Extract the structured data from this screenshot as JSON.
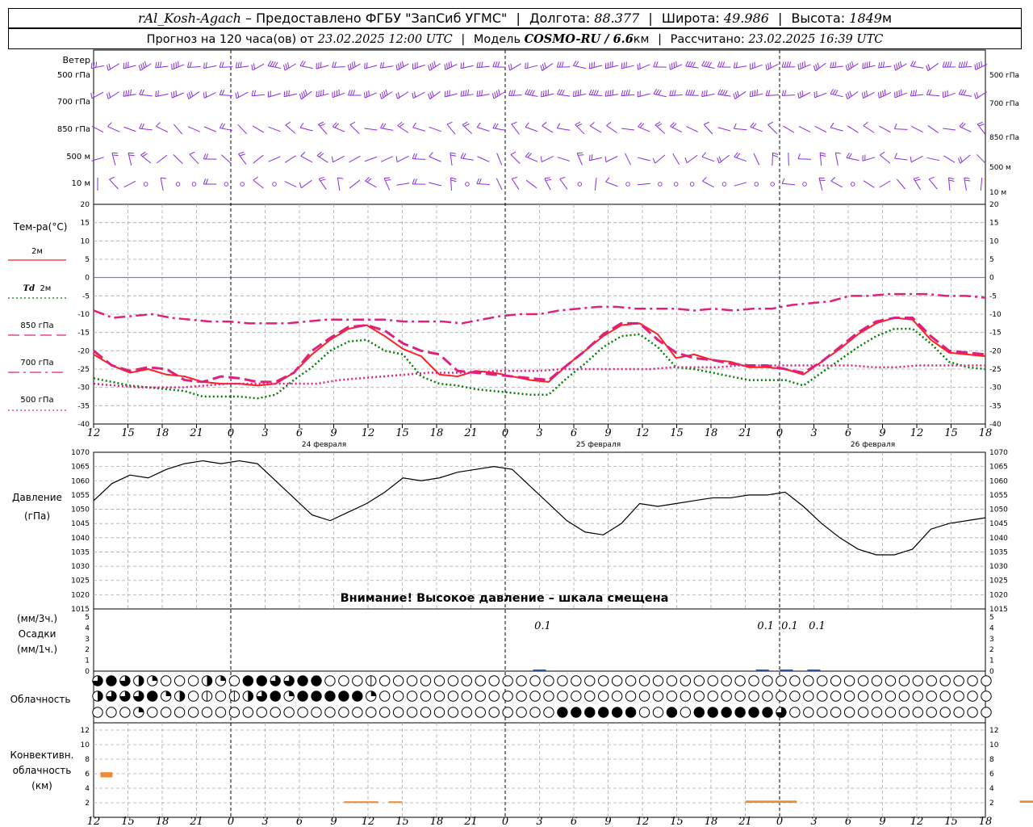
{
  "header": {
    "station": "rAl_Kosh-Agach",
    "dash": "–",
    "provider": "Предоставлено ФГБУ \"ЗапСиб УГМС\"",
    "lon_label": "Долгота:",
    "lon": "88.377",
    "lat_label": "Широта:",
    "lat": "49.986",
    "alt_label": "Высота:",
    "alt": "1849",
    "alt_unit": "м",
    "forecast_label": "Прогноз на 120 часа(ов)  от",
    "forecast_time": "23.02.2025 12:00 UTC",
    "model_label": "Модель",
    "model": "COSMO-RU / 6.6",
    "model_unit": "км",
    "calc_label": "Рассчитано:",
    "calc_time": "23.02.2025 16:39 UTC"
  },
  "panels": {
    "wind": {
      "title": "Ветер",
      "levels": [
        "500 гПа",
        "700 гПа",
        "850 гПа",
        "500 м",
        "10  м"
      ]
    },
    "temp": {
      "title": "Тем-ра(°C)",
      "legend": [
        {
          "label": "2м",
          "color": "#ff2020",
          "style": "solid"
        },
        {
          "label_it": "Td",
          "label": "2м",
          "color": "#008000",
          "style": "dotted"
        },
        {
          "label": "850 гПа",
          "color": "#e0207f",
          "style": "dashed"
        },
        {
          "label": "700 гПа",
          "color": "#e0207f",
          "style": "dashdot"
        },
        {
          "label": "500 гПа",
          "color": "#e0207f",
          "style": "dotted"
        }
      ]
    },
    "pressure": {
      "title": "Давление",
      "unit": "(гПа)",
      "warning": "Внимание! Высокое давление – шкала смещена"
    },
    "precip": {
      "unit1": "(мм/3ч.)",
      "title": "Осадки",
      "unit2": "(мм/1ч.)"
    },
    "clouds": {
      "title": "Облачность"
    },
    "convective": {
      "title1": "Конвективн.",
      "title2": "облачность",
      "unit": "(км)"
    }
  },
  "chart_data": [
    {
      "type": "line",
      "title": "Тем-ра(°C)",
      "x_hours_utc": [
        "12",
        "15",
        "18",
        "21",
        "0",
        "3",
        "6",
        "9",
        "12",
        "15",
        "18",
        "21",
        "0",
        "3",
        "6",
        "9",
        "12",
        "15",
        "18",
        "21",
        "0",
        "3",
        "6",
        "9",
        "12",
        "15",
        "18"
      ],
      "days": [
        {
          "label": "24 февраля",
          "tick_index": 7
        },
        {
          "label": "25 февраля",
          "tick_index": 15
        },
        {
          "label": "26 февраля",
          "tick_index": 23
        }
      ],
      "ylim": [
        -40,
        20
      ],
      "yticks": [
        20,
        15,
        10,
        5,
        0,
        -5,
        -10,
        -15,
        -20,
        -25,
        -30,
        -35,
        -40
      ],
      "series": [
        {
          "name": "2м",
          "color": "#ff2020",
          "values": [
            -21,
            -24,
            -26,
            -25,
            -26.5,
            -27,
            -28.5,
            -29,
            -29,
            -29.5,
            -29,
            -26,
            -21,
            -17,
            -14,
            -13,
            -16,
            -19.5,
            -21.5,
            -26.5,
            -27,
            -25.5,
            -26,
            -27,
            -28,
            -28.5,
            -24,
            -20,
            -16,
            -13,
            -12.5,
            -15.5,
            -22,
            -21,
            -22.5,
            -23,
            -24.5,
            -24.5,
            -25,
            -26.5,
            -23,
            -19.5,
            -15.5,
            -12.5,
            -11,
            -11.5,
            -17,
            -20.5,
            -21,
            -21.5
          ]
        },
        {
          "name": "Td 2м",
          "color": "#008000",
          "values": [
            -27.5,
            -28.5,
            -29.5,
            -30,
            -30.5,
            -31,
            -32.5,
            -32.5,
            -32.5,
            -33,
            -32,
            -28,
            -24.5,
            -20,
            -17.5,
            -17,
            -20,
            -21,
            -27,
            -29,
            -29.5,
            -30.5,
            -31,
            -31.5,
            -32,
            -32,
            -27.5,
            -23.5,
            -19,
            -16,
            -15.5,
            -19,
            -24.5,
            -25,
            -26,
            -27,
            -28,
            -28,
            -28,
            -29.5,
            -26,
            -22.5,
            -19,
            -16,
            -14,
            -14,
            -18,
            -23,
            -24.5,
            -25
          ]
        },
        {
          "name": "850 гПа",
          "color": "#e0207f",
          "values": [
            -20,
            -24,
            -25.5,
            -24.5,
            -25,
            -28,
            -28.5,
            -27,
            -27.5,
            -28.5,
            -28.5,
            -26,
            -20,
            -16.5,
            -13.5,
            -13,
            -14.5,
            -18,
            -20,
            -21,
            -25.5,
            -26,
            -26.5,
            -27,
            -27.5,
            -28,
            -24,
            -20,
            -15.5,
            -12.5,
            -12.5,
            -17,
            -20.5,
            -22,
            -22.5,
            -23.5,
            -24,
            -24,
            -25,
            -26,
            -23,
            -19,
            -15,
            -12,
            -11,
            -11,
            -16,
            -20,
            -20.5,
            -21
          ]
        },
        {
          "name": "700 гПа",
          "color": "#e0207f",
          "values": [
            -9,
            -11,
            -10.5,
            -10,
            -11,
            -11.5,
            -12,
            -12,
            -12.5,
            -12.5,
            -12.5,
            -12,
            -11.5,
            -11.5,
            -11.5,
            -11.5,
            -12,
            -12,
            -12,
            -12.5,
            -11.5,
            -10.5,
            -10,
            -10,
            -9,
            -8.5,
            -8,
            -8,
            -8.5,
            -8.5,
            -8.5,
            -9,
            -8.5,
            -9,
            -8.5,
            -8.5,
            -7.5,
            -7,
            -6.5,
            -5,
            -5,
            -4.5,
            -4.5,
            -4.5,
            -5,
            -5,
            -5.5
          ]
        },
        {
          "name": "500 гПа",
          "color": "#e0207f",
          "values": [
            -29,
            -29.5,
            -30,
            -30,
            -30,
            -29.5,
            -29,
            -29,
            -29,
            -29,
            -29,
            -28,
            -27.5,
            -27,
            -26.5,
            -26,
            -26,
            -26,
            -25.5,
            -25.5,
            -25.5,
            -25,
            -25,
            -25,
            -25,
            -25,
            -24.5,
            -24.5,
            -24.5,
            -24,
            -24,
            -24,
            -24,
            -24,
            -24,
            -24.5,
            -24.5,
            -24,
            -24,
            -24,
            -24
          ]
        }
      ]
    },
    {
      "type": "line",
      "title": "Давление",
      "ylabel": "(гПа)",
      "ylim": [
        1015,
        1070
      ],
      "yticks": [
        1070,
        1065,
        1060,
        1055,
        1050,
        1045,
        1040,
        1035,
        1030,
        1025,
        1020,
        1015
      ],
      "series": [
        {
          "name": "Давление",
          "color": "#000000",
          "values": [
            1053,
            1059,
            1062,
            1061,
            1064,
            1066,
            1067,
            1066,
            1067,
            1066,
            1060,
            1054,
            1048,
            1046,
            1049,
            1052,
            1056,
            1061,
            1060,
            1061,
            1063,
            1064,
            1065,
            1064,
            1058,
            1052,
            1046,
            1042,
            1041,
            1045,
            1052,
            1051,
            1052,
            1053,
            1054,
            1054,
            1055,
            1055,
            1056,
            1051,
            1045,
            1040,
            1036,
            1034,
            1034,
            1036,
            1043,
            1045,
            1046,
            1047
          ]
        }
      ]
    },
    {
      "type": "bar",
      "title": "Осадки",
      "ylim": [
        0,
        5
      ],
      "yticks": [
        5,
        4,
        3,
        2,
        1,
        0
      ],
      "annotations": [
        {
          "label": "0.1",
          "hour_index": 13
        },
        {
          "label": "0.1",
          "hour_index": 19.5
        },
        {
          "label": "0.1",
          "hour_index": 20.2
        },
        {
          "label": "0.1",
          "hour_index": 21
        }
      ]
    },
    {
      "type": "bar",
      "title": "Конвективн. облачность",
      "ylabel": "(км)",
      "ylim": [
        0,
        13
      ],
      "yticks": [
        12,
        10,
        8,
        6,
        4,
        2
      ],
      "bars": [
        {
          "from_hour": 0.2,
          "to_hour": 0.55,
          "bottom": 5.5,
          "top": 6.2
        },
        {
          "from_hour": 7.3,
          "to_hour": 8.3,
          "bottom": 2.0,
          "top": 2.2
        },
        {
          "from_hour": 8.6,
          "to_hour": 9.0,
          "bottom": 2.0,
          "top": 2.2
        },
        {
          "from_hour": 19.0,
          "to_hour": 20.5,
          "bottom": 2.0,
          "top": 2.3
        },
        {
          "from_hour": 27.0,
          "to_hour": 28.8,
          "bottom": 2.0,
          "top": 2.3
        }
      ]
    }
  ]
}
